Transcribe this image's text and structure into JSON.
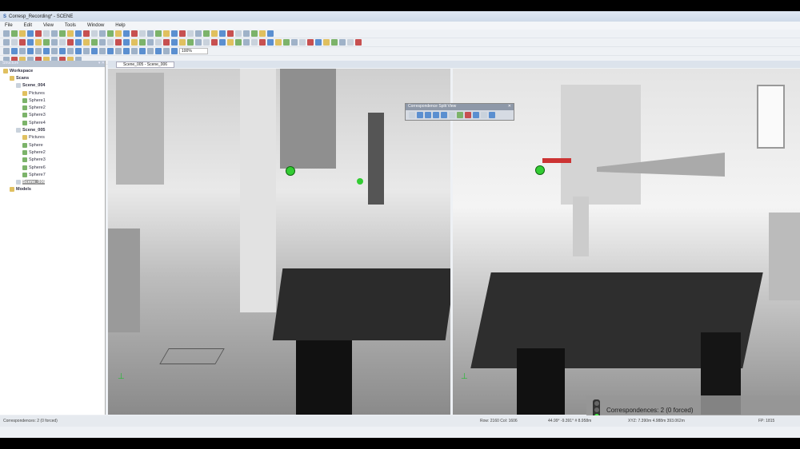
{
  "title": "Corresp_Recording* - SCENE",
  "menu": [
    "File",
    "Edit",
    "View",
    "Tools",
    "Window",
    "Help"
  ],
  "toolbar": {
    "zoom_value": "100%"
  },
  "sidebar": {
    "header": "Structure",
    "tree": [
      {
        "label": "Workspace",
        "level": 0
      },
      {
        "label": "Scans",
        "level": 1
      },
      {
        "label": "Scene_004",
        "level": 2
      },
      {
        "label": "Pictures",
        "level": 3
      },
      {
        "label": "Sphere1",
        "level": 3
      },
      {
        "label": "Sphere2",
        "level": 3
      },
      {
        "label": "Sphere3",
        "level": 3
      },
      {
        "label": "Sphere4",
        "level": 3
      },
      {
        "label": "Scene_005",
        "level": 2
      },
      {
        "label": "Pictures",
        "level": 3
      },
      {
        "label": "Sphere",
        "level": 3
      },
      {
        "label": "Sphere2",
        "level": 3
      },
      {
        "label": "Sphere3",
        "level": 3
      },
      {
        "label": "Sphere6",
        "level": 3
      },
      {
        "label": "Sphere7",
        "level": 3
      },
      {
        "label": "Scene_006",
        "level": 2
      },
      {
        "label": "Models",
        "level": 1
      }
    ]
  },
  "tab": {
    "label": "Scene_005 - Scene_006"
  },
  "split_view": {
    "title": "Correspondence Split View"
  },
  "correspondences": {
    "text": "Correspondences: 2 (0 forced)"
  },
  "status": {
    "left": "Correspondences: 2 (0 forced)",
    "rowcol": "Row: 2160  Col: 1606",
    "angles": "44.99°  -9.391°  # 8.958m",
    "xyz": "XYZ: 7.390m  4.988m  393.062m",
    "fp": "FP: 1815"
  }
}
